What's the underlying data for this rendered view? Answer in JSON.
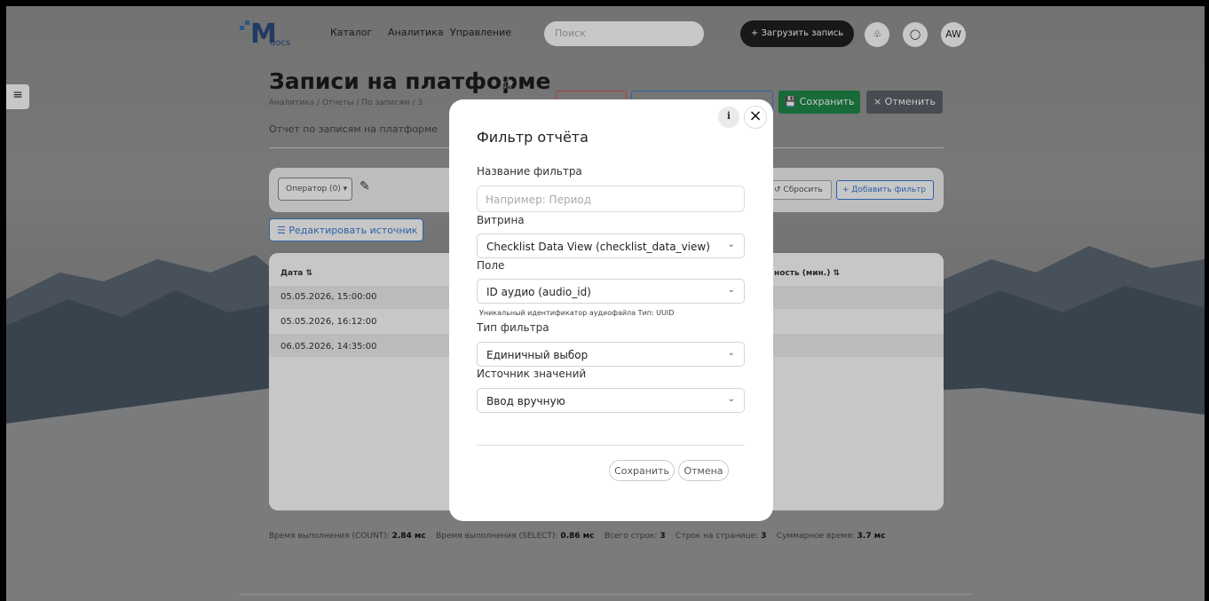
{
  "nav": {
    "logo_text": "M",
    "logo_sub": "docs",
    "items": [
      "Каталог",
      "Аналитика",
      "Управление"
    ],
    "search_placeholder": "Поиск",
    "upload_label": "+ Загрузить запись",
    "user_initials": "AW"
  },
  "page": {
    "title": "Записи на платформе",
    "breadcrumb": "Аналитика  /  Отчеты  /  По записям  /  З",
    "subtitle": "Отчет по записям на платформе",
    "save_label": "Сохранить",
    "cancel_label": "× Отменить",
    "operator_label": "Оператор (0)",
    "reset_label": "Сбросить",
    "add_filter_label": "+ Добавить фильтр",
    "edit_source_label": "Редактировать источник"
  },
  "table": {
    "col_date": "Дата",
    "col_duration": "ность (мин.)",
    "rows": [
      "05.05.2026, 15:00:00",
      "05.05.2026, 16:12:00",
      "06.05.2026, 14:35:00"
    ]
  },
  "footer": {
    "count_label": "Время выполнения (COUNT): ",
    "count_value": "2.84 мс",
    "select_label": "Время выполнения (SELECT): ",
    "select_value": "0.86 мс",
    "total_label": "Всего строк: ",
    "total_value": "3",
    "per_page_label": "Строк на странице: ",
    "per_page_value": "3",
    "sum_label": "Суммарное время: ",
    "sum_value": "3.7 мс"
  },
  "modal": {
    "title": "Фильтр отчёта",
    "name_label": "Название фильтра",
    "name_placeholder": "Например: Период",
    "view_label": "Витрина",
    "view_value": "Checklist Data View (checklist_data_view)",
    "field_label": "Поле",
    "field_value": "ID аудио (audio_id)",
    "field_help": "Уникальный идентификатор аудиофайла Тип: UUID",
    "type_label": "Тип фильтра",
    "type_value": "Единичный выбор",
    "source_label": "Источник значений",
    "source_value": "Ввод вручную",
    "save_label": "Сохранить",
    "cancel_label": "Отмена"
  }
}
